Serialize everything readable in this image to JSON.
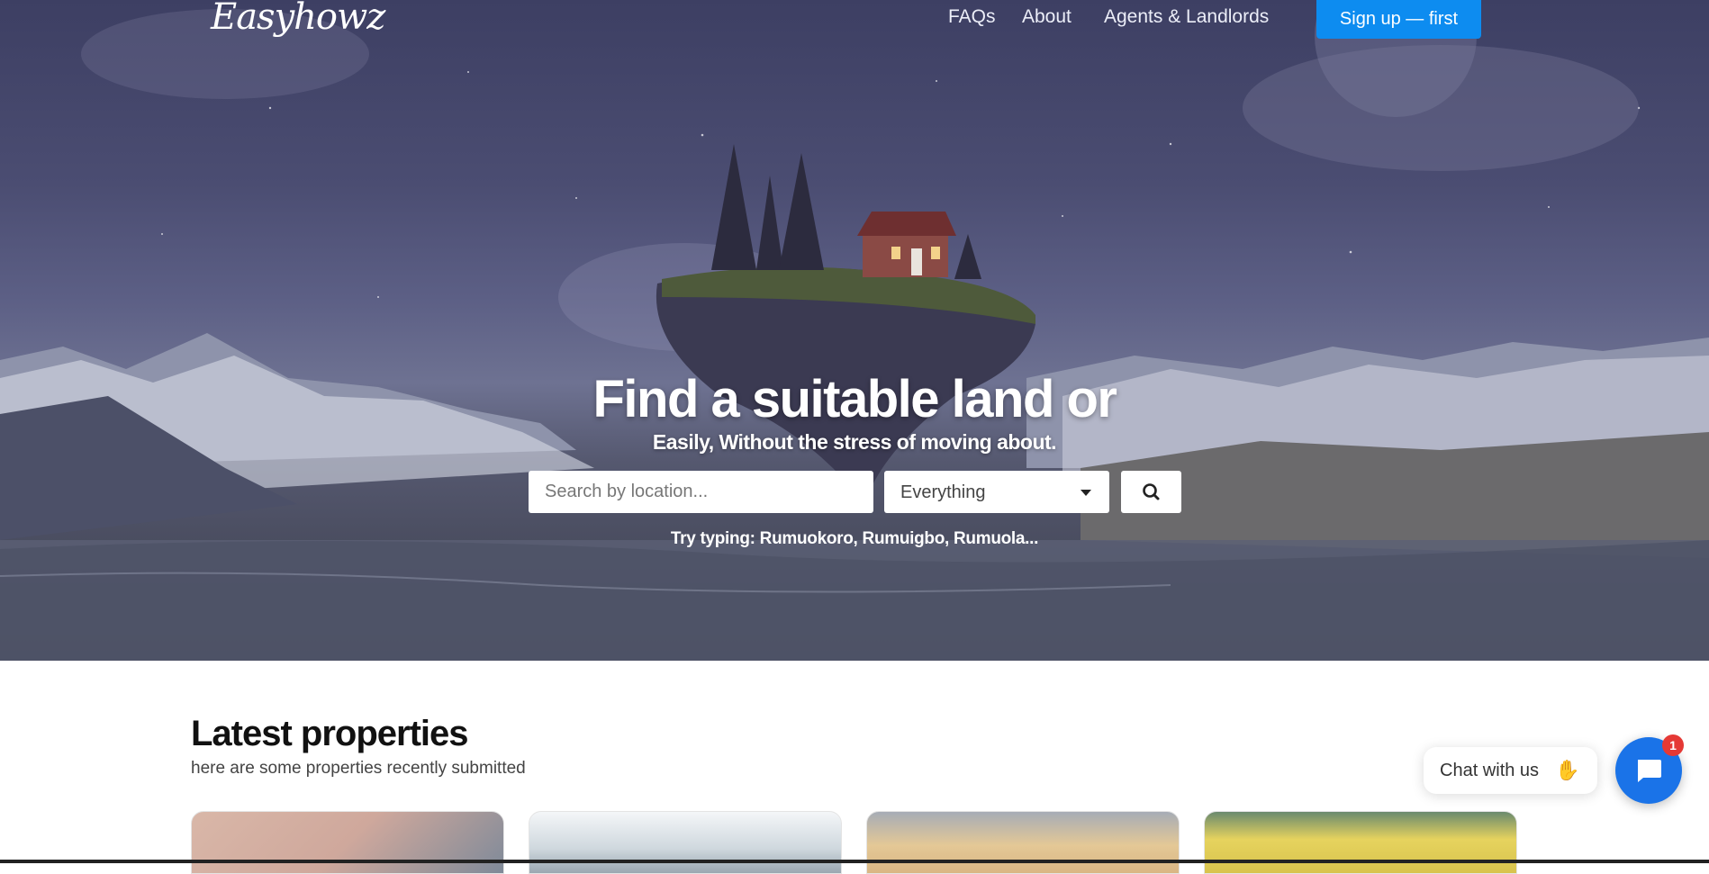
{
  "nav": {
    "logo": "Easyhowz",
    "links": [
      "FAQs",
      "About",
      "Agents & Landlords"
    ],
    "signup_label": "Sign up — first"
  },
  "hero": {
    "headline": "Find a suitable land or",
    "subline": "Easily, Without the stress of moving about.",
    "search_placeholder": "Search by location...",
    "type_selected": "Everything",
    "hint": "Try typing: Rumuokoro, Rumuigbo, Rumuola..."
  },
  "latest": {
    "title": "Latest properties",
    "subtitle": "here are some properties recently submitted"
  },
  "chat": {
    "label": "Chat with us",
    "badge": "1"
  },
  "icons": [
    "search-icon",
    "caret-down-icon",
    "chat-icon",
    "wave-hand-icon"
  ],
  "colors": {
    "accent": "#0d8cf0",
    "chat_button": "#1a73e8",
    "badge": "#e53935"
  }
}
